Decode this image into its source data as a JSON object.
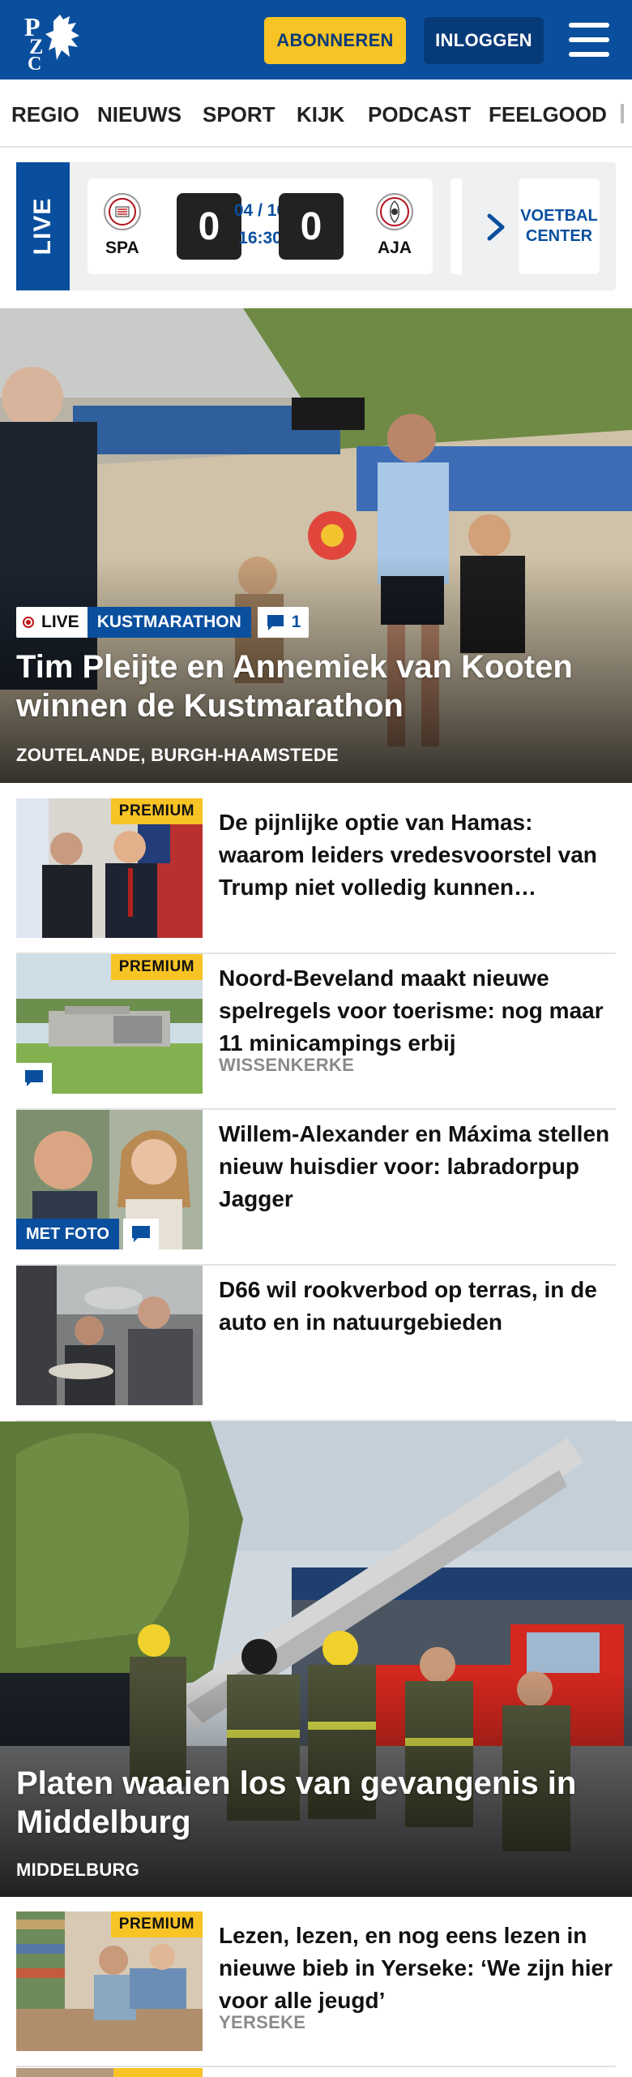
{
  "header": {
    "logo_text": "PZC",
    "subscribe_label": "ABONNEREN",
    "login_label": "INLOGGEN",
    "colors": {
      "brand": "#0a4f9e",
      "accent": "#f7c325"
    }
  },
  "nav": {
    "items": [
      "REGIO",
      "NIEUWS",
      "SPORT",
      "KIJK",
      "PODCAST",
      "FEELGOOD"
    ]
  },
  "live": {
    "label": "LIVE",
    "match": {
      "home": "SPA",
      "away": "AJA",
      "home_score": "0",
      "away_score": "0",
      "date": "04 / 10",
      "time": "16:30"
    },
    "voetbal_center": "VOETBAL CENTER"
  },
  "hero": {
    "live_label": "LIVE",
    "category": "KUSTMARATHON",
    "comments": "1",
    "title": "Tim Pleijte en Annemiek van Kooten winnen de Kustmarathon",
    "location": "ZOUTELANDE, BURGH-HAAMSTEDE"
  },
  "articles": [
    {
      "premium": "PREMIUM",
      "title": "De pijnlijke optie van Hamas: waarom leiders vredesvoorstel van Trump niet volledig kunnen…",
      "location": ""
    },
    {
      "premium": "PREMIUM",
      "title": "Noord-Beveland maakt nieuwe spelregels voor toerisme: nog maar 11 minicampings erbij",
      "location": "WISSENKERKE"
    },
    {
      "badge": "MET FOTO",
      "title": "Willem-Alexander en Máxima stellen nieuw huisdier voor: labradorpup Jagger",
      "location": ""
    },
    {
      "title": "D66 wil rookverbod op terras, in de auto en in natuurgebieden",
      "location": ""
    }
  ],
  "hero2": {
    "title": "Platen waaien los van gevangenis in Middelburg",
    "location": "MIDDELBURG"
  },
  "articles2": [
    {
      "premium": "PREMIUM",
      "title": "Lezen, lezen, en nog eens lezen in nieuwe bieb in Yerseke: ‘We zijn hier voor alle jeugd’",
      "location": "YERSEKE"
    }
  ]
}
